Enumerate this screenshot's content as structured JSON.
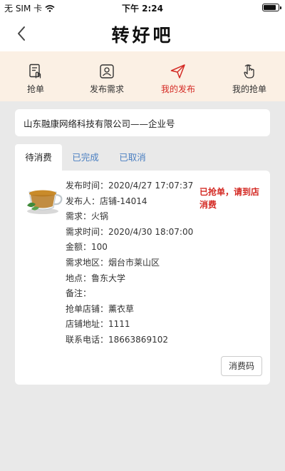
{
  "status_bar": {
    "carrier": "无 SIM 卡",
    "time": "下午 2:24"
  },
  "nav": {
    "brand": "转好吧"
  },
  "tabs": [
    {
      "label": "抢单",
      "icon": "grab-order-icon"
    },
    {
      "label": "发布需求",
      "icon": "publish-icon"
    },
    {
      "label": "我的发布",
      "icon": "send-icon"
    },
    {
      "label": "我的抢单",
      "icon": "hand-tap-icon"
    }
  ],
  "company": {
    "text": "山东融康网络科技有限公司——企业号"
  },
  "order_tabs": [
    {
      "label": "待消费"
    },
    {
      "label": "已完成"
    },
    {
      "label": "已取消"
    }
  ],
  "order": {
    "rows": [
      "发布时间：2020/4/27 17:07:37",
      "发布人：店铺-14014",
      "需求：火锅",
      "需求时间：2020/4/30 18:07:00",
      "金额：100",
      "需求地区：烟台市莱山区",
      "地点：鲁东大学",
      "备注：",
      "抢单店铺：薰衣草",
      "店铺地址：1111",
      "联系电话：18663869102"
    ],
    "status_line1": "已抢单，请到店",
    "status_line2": "消费",
    "code_button": "消费码"
  },
  "colors": {
    "accent": "#d42a24",
    "tab_bg": "#fbf0e4",
    "link": "#4a7fc1",
    "page_bg": "#e9e9e9"
  }
}
